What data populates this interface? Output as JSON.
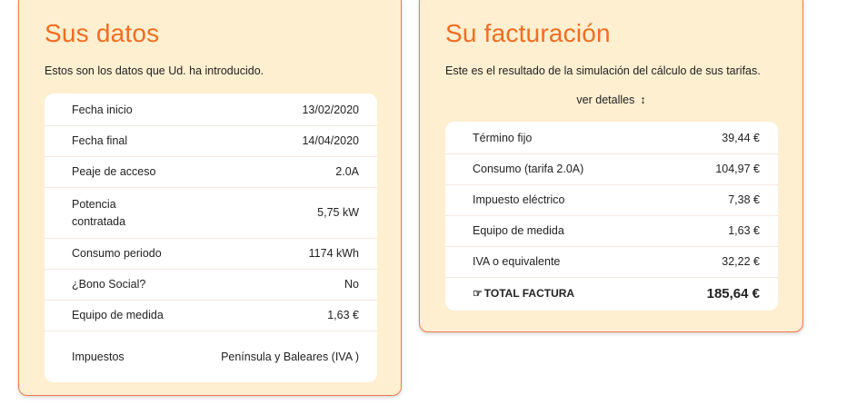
{
  "datos": {
    "title": "Sus datos",
    "intro": "Estos son los datos que Ud. ha introducido.",
    "rows": [
      {
        "label": "Fecha inicio",
        "value": "13/02/2020"
      },
      {
        "label": "Fecha final",
        "value": "14/04/2020"
      },
      {
        "label": "Peaje de acceso",
        "value": "2.0A"
      },
      {
        "label": "Potencia contratada",
        "value": "5,75 kW"
      },
      {
        "label": "Consumo periodo",
        "value": "1174 kWh"
      },
      {
        "label": "¿Bono Social?",
        "value": "No"
      },
      {
        "label": "Equipo de medida",
        "value": "1,63 €"
      },
      {
        "label": "Impuestos",
        "value": "Península y Baleares (IVA )"
      }
    ]
  },
  "facturacion": {
    "title": "Su facturación",
    "intro": "Este es el resultado de la simulación del cálculo de sus tarifas.",
    "details_link": "ver detalles",
    "details_icon": "up-down-arrow-icon",
    "rows": [
      {
        "label": "Término fijo",
        "value": "39,44 €"
      },
      {
        "label": "Consumo (tarifa 2.0A)",
        "value": "104,97 €"
      },
      {
        "label": "Impuesto eléctrico",
        "value": "7,38 €"
      },
      {
        "label": "Equipo de medida",
        "value": "1,63 €"
      },
      {
        "label": "IVA o equivalente",
        "value": "32,22 €"
      }
    ],
    "total": {
      "icon": "pointing-hand-icon",
      "label": "TOTAL FACTURA",
      "value": "185,64 €"
    }
  },
  "colors": {
    "accent": "#f26d21",
    "card_bg": "#fdefd0",
    "border": "#f2784b"
  }
}
